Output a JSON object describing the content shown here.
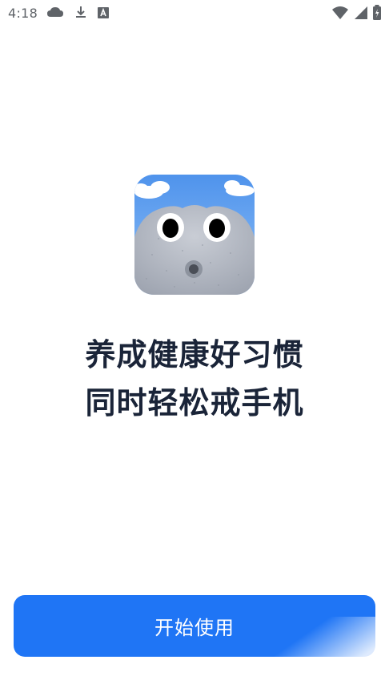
{
  "status_bar": {
    "time": "4:18",
    "left_icons": [
      "cloud-icon",
      "download-icon",
      "font-a-icon"
    ],
    "right_icons": [
      "wifi-icon",
      "signal-icon",
      "battery-icon"
    ]
  },
  "app_icon": {
    "name": "app-mascot-icon"
  },
  "headline": {
    "line1": "养成健康好习惯",
    "line2": "同时轻松戒手机"
  },
  "start_button": {
    "label": "开始使用"
  },
  "colors": {
    "primary": "#1f75f5",
    "headline": "#1a2438",
    "sky": "#5b9ef0",
    "mascot_gray": "#b7bcc6"
  }
}
